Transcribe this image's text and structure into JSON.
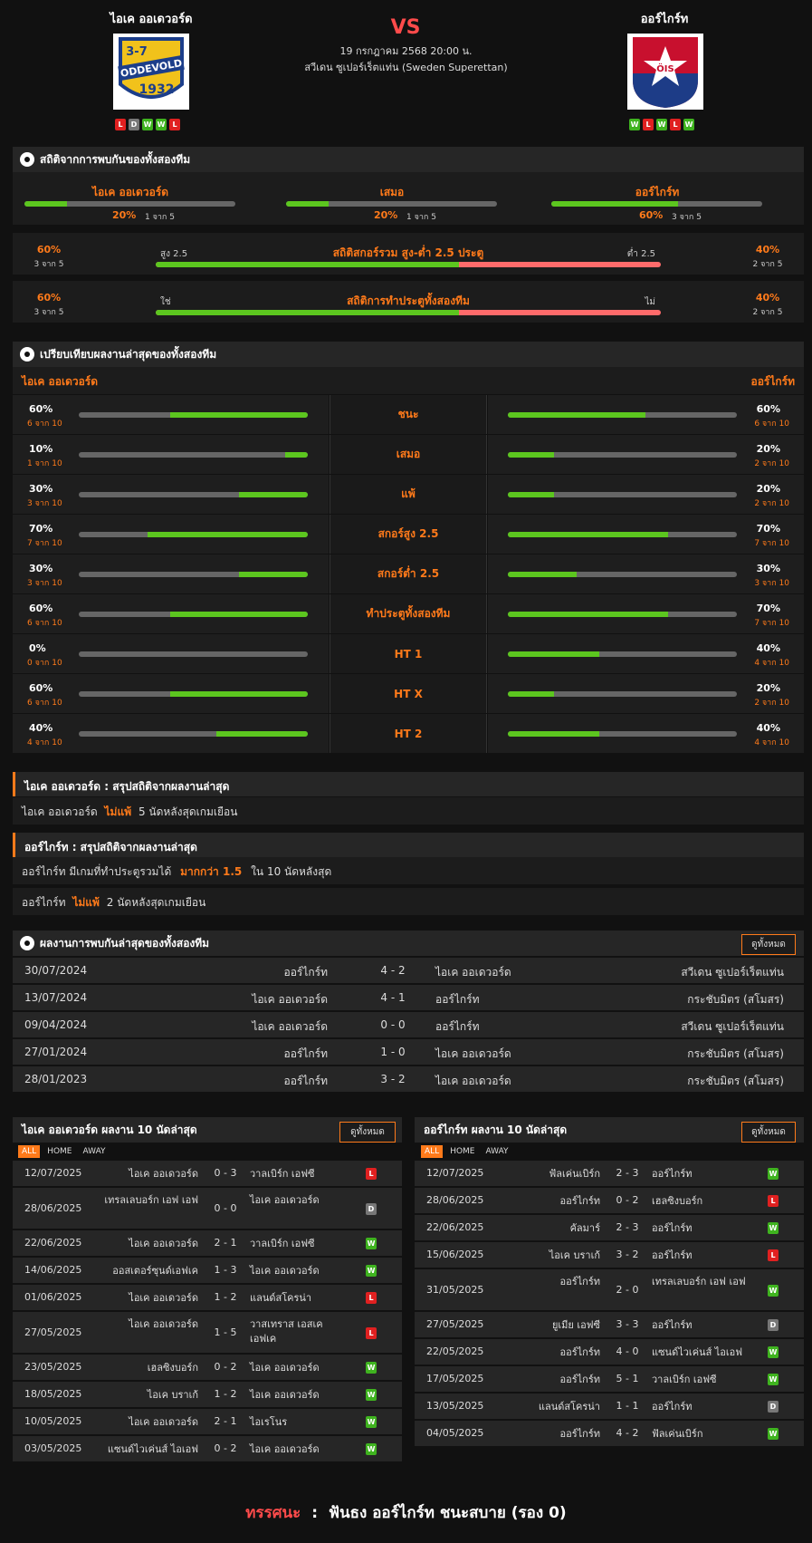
{
  "match": {
    "home": "ไอเค ออเดวอร์ด",
    "away": "ออร์ไกร์ท",
    "vs": "VS",
    "datetime": "19 กรกฎาคม 2568 20:00 น.",
    "league": "สวีเดน ซูเปอร์เร็ตแท่น (Sweden Superettan)",
    "home_form": [
      "L",
      "D",
      "W",
      "W",
      "L"
    ],
    "away_form": [
      "W",
      "L",
      "W",
      "L",
      "W"
    ],
    "home_logo_text": {
      "top": "3-7",
      "name": "ODDEVOLD",
      "year": "1932"
    },
    "away_logo_text": "ÖIS"
  },
  "h2h_stats": {
    "title": "สถิติจากการพบกันของทั้งสองทีม",
    "items": [
      {
        "label": "ไอเค ออเดวอร์ด",
        "pct": "20%",
        "sub": "1 จาก 5",
        "value": 0.2
      },
      {
        "label": "เสมอ",
        "pct": "20%",
        "sub": "1 จาก 5",
        "value": 0.2
      },
      {
        "label": "ออร์ไกร์ท",
        "pct": "60%",
        "sub": "3 จาก 5",
        "value": 0.6
      }
    ]
  },
  "ou": {
    "title": "สถิติสกอร์รวม สูง-ต่ำ 2.5 ประตู",
    "left_pct": "60%",
    "left_sub": "3 จาก 5",
    "right_pct": "40%",
    "right_sub": "2 จาก 5",
    "left_label": "สูง 2.5",
    "right_label": "ต่ำ 2.5",
    "value": 0.6
  },
  "btts": {
    "title": "สถิติการทำประตูทั้งสองทีม",
    "left_pct": "60%",
    "left_sub": "3 จาก 5",
    "right_pct": "40%",
    "right_sub": "2 จาก 5",
    "left_label": "ใช่",
    "right_label": "ไม่",
    "value": 0.6
  },
  "compare": {
    "title": "เปรียบเทียบผลงานล่าสุดของทั้งสองทีม",
    "home": "ไอเค ออเดวอร์ด",
    "away": "ออร์ไกร์ท",
    "rows": [
      {
        "label": "ชนะ",
        "hp": "60%",
        "hs": "6 จาก 10",
        "hv": 0.6,
        "ap": "60%",
        "as": "6 จาก 10",
        "av": 0.6
      },
      {
        "label": "เสมอ",
        "hp": "10%",
        "hs": "1 จาก 10",
        "hv": 0.1,
        "ap": "20%",
        "as": "2 จาก 10",
        "av": 0.2
      },
      {
        "label": "แพ้",
        "hp": "30%",
        "hs": "3 จาก 10",
        "hv": 0.3,
        "ap": "20%",
        "as": "2 จาก 10",
        "av": 0.2
      },
      {
        "label": "สกอร์สูง 2.5",
        "hp": "70%",
        "hs": "7 จาก 10",
        "hv": 0.7,
        "ap": "70%",
        "as": "7 จาก 10",
        "av": 0.7
      },
      {
        "label": "สกอร์ต่ำ 2.5",
        "hp": "30%",
        "hs": "3 จาก 10",
        "hv": 0.3,
        "ap": "30%",
        "as": "3 จาก 10",
        "av": 0.3
      },
      {
        "label": "ทำประตูทั้งสองทีม",
        "hp": "60%",
        "hs": "6 จาก 10",
        "hv": 0.6,
        "ap": "70%",
        "as": "7 จาก 10",
        "av": 0.7
      },
      {
        "label": "HT 1",
        "hp": "0%",
        "hs": "0 จาก 10",
        "hv": 0,
        "ap": "40%",
        "as": "4 จาก 10",
        "av": 0.4
      },
      {
        "label": "HT X",
        "hp": "60%",
        "hs": "6 จาก 10",
        "hv": 0.6,
        "ap": "20%",
        "as": "2 จาก 10",
        "av": 0.2
      },
      {
        "label": "HT 2",
        "hp": "40%",
        "hs": "4 จาก 10",
        "hv": 0.4,
        "ap": "40%",
        "as": "4 จาก 10",
        "av": 0.4
      }
    ]
  },
  "summary": {
    "home_title": "ไอเค ออเดวอร์ด : สรุปสถิติจากผลงานล่าสุด",
    "home_l1": {
      "a": "ไอเค ออเดวอร์ด",
      "b": "ไม่แพ้",
      "c": "5  นัดหลังสุดเกมเยือน"
    },
    "away_title": "ออร์ไกร์ท : สรุปสถิติจากผลงานล่าสุด",
    "away_l1": {
      "a": "ออร์ไกร์ท  มีเกมที่ทำประตูรวมได้",
      "b": "มากกว่า  1.5",
      "c": "ใน 10 นัดหลังสุด"
    },
    "away_l2": {
      "a": "ออร์ไกร์ท",
      "b": "ไม่แพ้",
      "c": "2  นัดหลังสุดเกมเยือน"
    }
  },
  "h2h": {
    "title": "ผลงานการพบกันล่าสุดของทั้งสองทีม",
    "all": "ดูทั้งหมด",
    "rows": [
      {
        "date": "30/07/2024",
        "home": "ออร์ไกร์ท",
        "score": "4 - 2",
        "away": "ไอเค ออเดวอร์ด",
        "comp": "สวีเดน ซูเปอร์เร็ตแท่น"
      },
      {
        "date": "13/07/2024",
        "home": "ไอเค ออเดวอร์ด",
        "score": "4 - 1",
        "away": "ออร์ไกร์ท",
        "comp": "กระชับมิตร (สโมสร)"
      },
      {
        "date": "09/04/2024",
        "home": "ไอเค ออเดวอร์ด",
        "score": "0 - 0",
        "away": "ออร์ไกร์ท",
        "comp": "สวีเดน ซูเปอร์เร็ตแท่น"
      },
      {
        "date": "27/01/2024",
        "home": "ออร์ไกร์ท",
        "score": "1 - 0",
        "away": "ไอเค ออเดวอร์ด",
        "comp": "กระชับมิตร (สโมสร)"
      },
      {
        "date": "28/01/2023",
        "home": "ออร์ไกร์ท",
        "score": "3 - 2",
        "away": "ไอเค ออเดวอร์ด",
        "comp": "กระชับมิตร (สโมสร)"
      }
    ]
  },
  "last10": {
    "tabs": [
      "ALL",
      "HOME",
      "AWAY"
    ],
    "all": "ดูทั้งหมด",
    "home_title": "ไอเค ออเดวอร์ด ผลงาน 10 นัดล่าสุด",
    "away_title": "ออร์ไกร์ท ผลงาน 10 นัดล่าสุด",
    "home": [
      {
        "date": "12/07/2025",
        "home": "ไอเค ออเดวอร์ด",
        "score": "0 - 3",
        "away": "วาลเบิร์ก เอฟซี",
        "r": "L"
      },
      {
        "date": "28/06/2025",
        "home": "เทรลเลบอร์ก เอฟ เอฟ",
        "score": "0 - 0",
        "away": "ไอเค ออเดวอร์ด",
        "r": "D"
      },
      {
        "date": "22/06/2025",
        "home": "ไอเค ออเดวอร์ด",
        "score": "2 - 1",
        "away": "วาลเบิร์ก เอฟซี",
        "r": "W"
      },
      {
        "date": "14/06/2025",
        "home": "ออสเตอร์ซุนด์เอฟเค",
        "score": "1 - 3",
        "away": "ไอเค ออเดวอร์ด",
        "r": "W"
      },
      {
        "date": "01/06/2025",
        "home": "ไอเค ออเดวอร์ด",
        "score": "1 - 2",
        "away": "แลนด์สโครน่า",
        "r": "L"
      },
      {
        "date": "27/05/2025",
        "home": "ไอเค ออเดวอร์ด",
        "score": "1 - 5",
        "away": "วาสเทราส เอสเค เอฟเค",
        "r": "L"
      },
      {
        "date": "23/05/2025",
        "home": "เฮลซิงบอร์ก",
        "score": "0 - 2",
        "away": "ไอเค ออเดวอร์ด",
        "r": "W"
      },
      {
        "date": "18/05/2025",
        "home": "ไอเค บราเก้",
        "score": "1 - 2",
        "away": "ไอเค ออเดวอร์ด",
        "r": "W"
      },
      {
        "date": "10/05/2025",
        "home": "ไอเค ออเดวอร์ด",
        "score": "2 - 1",
        "away": "ไอเรโนร",
        "r": "W"
      },
      {
        "date": "03/05/2025",
        "home": "แซนด์ไวเค่นส์ ไอเอฟ",
        "score": "0 - 2",
        "away": "ไอเค ออเดวอร์ด",
        "r": "W"
      }
    ],
    "away": [
      {
        "date": "12/07/2025",
        "home": "ฟัลเค่นเบิร์ก",
        "score": "2 - 3",
        "away": "ออร์ไกร์ท",
        "r": "W"
      },
      {
        "date": "28/06/2025",
        "home": "ออร์ไกร์ท",
        "score": "0 - 2",
        "away": "เฮลซิงบอร์ก",
        "r": "L"
      },
      {
        "date": "22/06/2025",
        "home": "คัลมาร์",
        "score": "2 - 3",
        "away": "ออร์ไกร์ท",
        "r": "W"
      },
      {
        "date": "15/06/2025",
        "home": "ไอเค บราเก้",
        "score": "3 - 2",
        "away": "ออร์ไกร์ท",
        "r": "L"
      },
      {
        "date": "31/05/2025",
        "home": "ออร์ไกร์ท",
        "score": "2 - 0",
        "away": "เทรลเลบอร์ก เอฟ เอฟ",
        "r": "W"
      },
      {
        "date": "27/05/2025",
        "home": "ยูเมีย เอฟซี",
        "score": "3 - 3",
        "away": "ออร์ไกร์ท",
        "r": "D"
      },
      {
        "date": "22/05/2025",
        "home": "ออร์ไกร์ท",
        "score": "4 - 0",
        "away": "แซนด์ไวเค่นส์ ไอเอฟ",
        "r": "W"
      },
      {
        "date": "17/05/2025",
        "home": "ออร์ไกร์ท",
        "score": "5 - 1",
        "away": "วาลเบิร์ก เอฟซี",
        "r": "W"
      },
      {
        "date": "13/05/2025",
        "home": "แลนด์สโครน่า",
        "score": "1 - 1",
        "away": "ออร์ไกร์ท",
        "r": "D"
      },
      {
        "date": "04/05/2025",
        "home": "ออร์ไกร์ท",
        "score": "4 - 2",
        "away": "ฟัลเค่นเบิร์ก",
        "r": "W"
      }
    ]
  },
  "prediction": {
    "label": "ทรรศนะ",
    "sep": ":",
    "text": "ฟันธง ออร์ไกร์ท ชนะสบาย (รอง 0)"
  },
  "colors": {
    "accent": "#ff7a1a",
    "green": "#5cc61f",
    "red": "#ff6b6b",
    "win": "#3fb31f",
    "loss": "#e02020",
    "draw": "#777777"
  }
}
